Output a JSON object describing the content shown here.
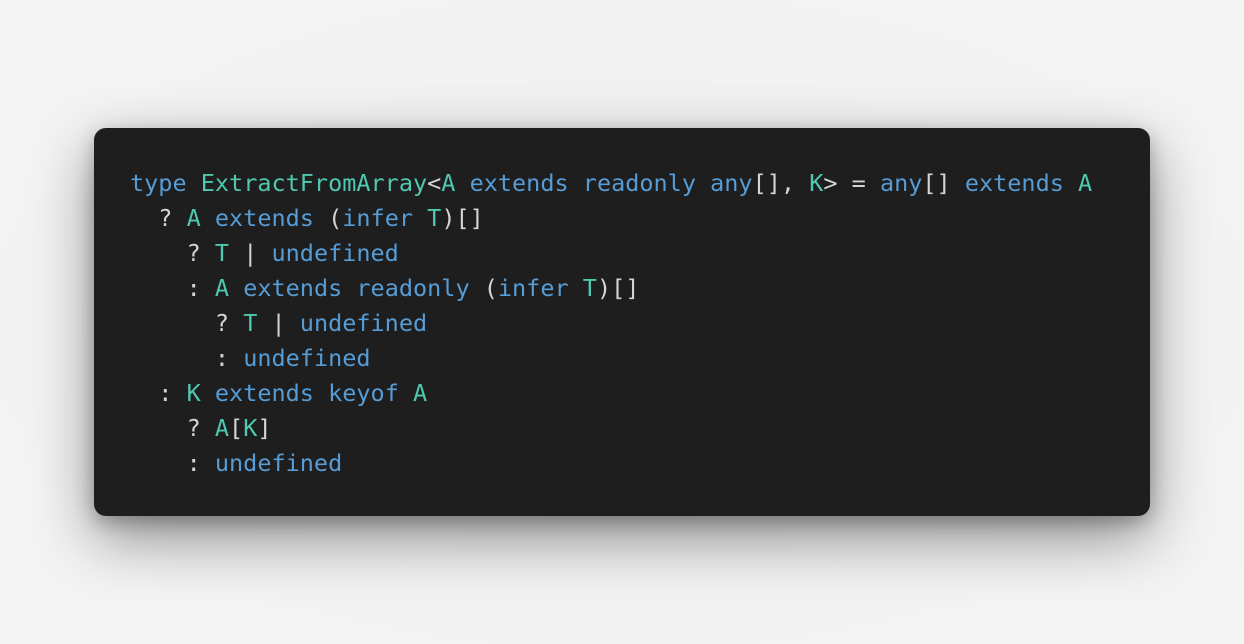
{
  "colors": {
    "background": "#f0f0f0",
    "editor_background": "#1e1e1e",
    "keyword": "#569cd6",
    "type": "#4ec9b0",
    "punctuation": "#d4d4d4"
  },
  "code_lines": [
    [
      {
        "t": "type",
        "k": "kw"
      },
      {
        "t": " ",
        "k": "pn"
      },
      {
        "t": "ExtractFromArray",
        "k": "ty"
      },
      {
        "t": "<",
        "k": "pn"
      },
      {
        "t": "A",
        "k": "ty"
      },
      {
        "t": " ",
        "k": "pn"
      },
      {
        "t": "extends",
        "k": "kw"
      },
      {
        "t": " ",
        "k": "pn"
      },
      {
        "t": "readonly",
        "k": "kw"
      },
      {
        "t": " ",
        "k": "pn"
      },
      {
        "t": "any",
        "k": "kw"
      },
      {
        "t": "[], ",
        "k": "pn"
      },
      {
        "t": "K",
        "k": "ty"
      },
      {
        "t": "> = ",
        "k": "pn"
      },
      {
        "t": "any",
        "k": "kw"
      },
      {
        "t": "[] ",
        "k": "pn"
      },
      {
        "t": "extends",
        "k": "kw"
      },
      {
        "t": " ",
        "k": "pn"
      },
      {
        "t": "A",
        "k": "ty"
      }
    ],
    [
      {
        "t": "  ? ",
        "k": "pn"
      },
      {
        "t": "A",
        "k": "ty"
      },
      {
        "t": " ",
        "k": "pn"
      },
      {
        "t": "extends",
        "k": "kw"
      },
      {
        "t": " (",
        "k": "pn"
      },
      {
        "t": "infer",
        "k": "kw"
      },
      {
        "t": " ",
        "k": "pn"
      },
      {
        "t": "T",
        "k": "ty"
      },
      {
        "t": ")[]",
        "k": "pn"
      }
    ],
    [
      {
        "t": "    ? ",
        "k": "pn"
      },
      {
        "t": "T",
        "k": "ty"
      },
      {
        "t": " | ",
        "k": "pn"
      },
      {
        "t": "undefined",
        "k": "kw"
      }
    ],
    [
      {
        "t": "    : ",
        "k": "pn"
      },
      {
        "t": "A",
        "k": "ty"
      },
      {
        "t": " ",
        "k": "pn"
      },
      {
        "t": "extends",
        "k": "kw"
      },
      {
        "t": " ",
        "k": "pn"
      },
      {
        "t": "readonly",
        "k": "kw"
      },
      {
        "t": " (",
        "k": "pn"
      },
      {
        "t": "infer",
        "k": "kw"
      },
      {
        "t": " ",
        "k": "pn"
      },
      {
        "t": "T",
        "k": "ty"
      },
      {
        "t": ")[]",
        "k": "pn"
      }
    ],
    [
      {
        "t": "      ? ",
        "k": "pn"
      },
      {
        "t": "T",
        "k": "ty"
      },
      {
        "t": " | ",
        "k": "pn"
      },
      {
        "t": "undefined",
        "k": "kw"
      }
    ],
    [
      {
        "t": "      : ",
        "k": "pn"
      },
      {
        "t": "undefined",
        "k": "kw"
      }
    ],
    [
      {
        "t": "  : ",
        "k": "pn"
      },
      {
        "t": "K",
        "k": "ty"
      },
      {
        "t": " ",
        "k": "pn"
      },
      {
        "t": "extends",
        "k": "kw"
      },
      {
        "t": " ",
        "k": "pn"
      },
      {
        "t": "keyof",
        "k": "kw"
      },
      {
        "t": " ",
        "k": "pn"
      },
      {
        "t": "A",
        "k": "ty"
      }
    ],
    [
      {
        "t": "    ? ",
        "k": "pn"
      },
      {
        "t": "A",
        "k": "ty"
      },
      {
        "t": "[",
        "k": "pn"
      },
      {
        "t": "K",
        "k": "ty"
      },
      {
        "t": "]",
        "k": "pn"
      }
    ],
    [
      {
        "t": "    : ",
        "k": "pn"
      },
      {
        "t": "undefined",
        "k": "kw"
      }
    ]
  ]
}
